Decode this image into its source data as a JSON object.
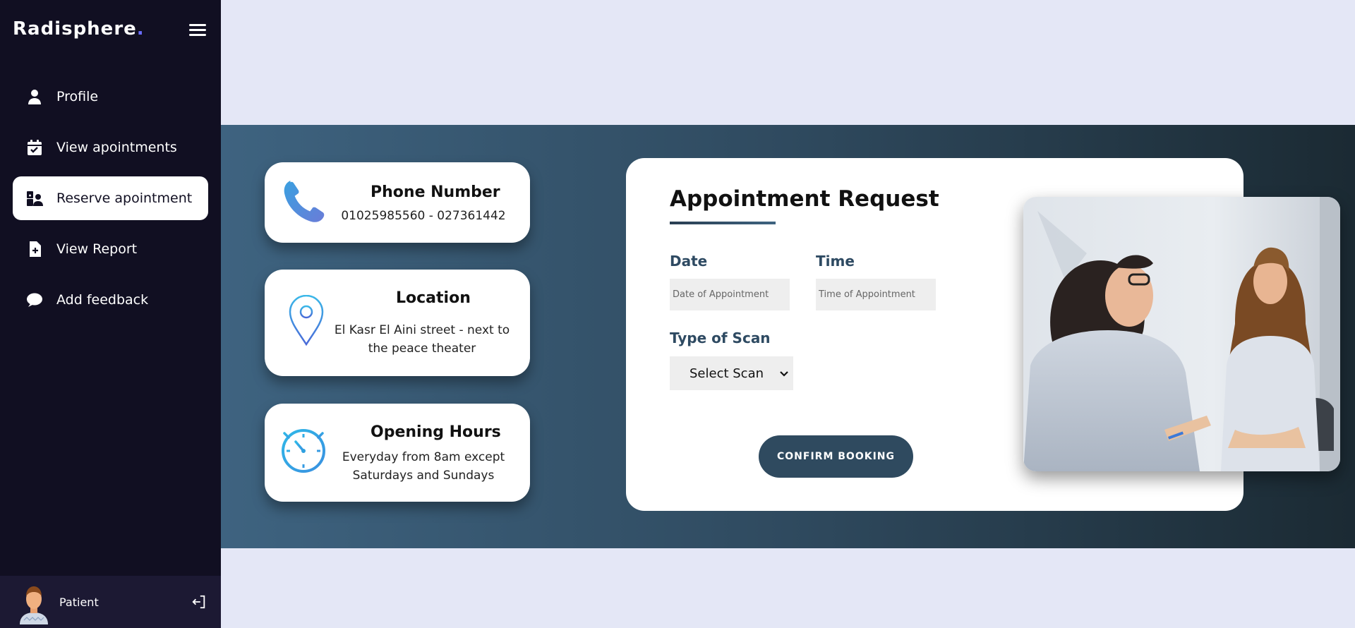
{
  "brand": {
    "name": "Radisphere",
    "dot": "."
  },
  "sidebar": {
    "items": [
      {
        "label": "Profile",
        "icon": "person-icon"
      },
      {
        "label": "View apointments",
        "icon": "calendar-check-icon"
      },
      {
        "label": "Reserve apointment",
        "icon": "doctor-icon",
        "active": true
      },
      {
        "label": "View Report",
        "icon": "file-plus-icon"
      },
      {
        "label": "Add feedback",
        "icon": "comment-icon"
      }
    ],
    "profile": {
      "name": "Patient"
    }
  },
  "info": {
    "phone": {
      "title": "Phone Number",
      "text": "01025985560 - 027361442"
    },
    "location": {
      "title": "Location",
      "text": "El Kasr El Aini street - next to the peace theater"
    },
    "hours": {
      "title": "Opening Hours",
      "text": "Everyday from 8am except Saturdays and Sundays"
    }
  },
  "form": {
    "title": "Appointment Request",
    "date_label": "Date",
    "date_placeholder": "Date of Appointment",
    "time_label": "Time",
    "time_placeholder": "Time of Appointment",
    "scan_label": "Type of Scan",
    "scan_selected": "Select Scan",
    "confirm_label": "CONFIRM BOOKING"
  },
  "colors": {
    "sidebar_bg": "#110f22",
    "accent": "#2f4a5f",
    "brand_dot": "#6a6cff",
    "page_bg": "#e4e7f6"
  }
}
